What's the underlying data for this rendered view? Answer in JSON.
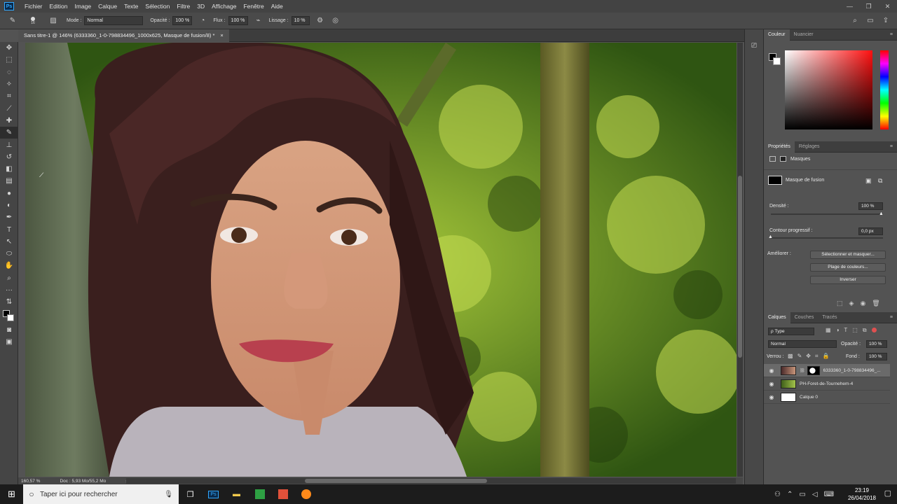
{
  "menu": [
    "Fichier",
    "Edition",
    "Image",
    "Calque",
    "Texte",
    "Sélection",
    "Filtre",
    "3D",
    "Affichage",
    "Fenêtre",
    "Aide"
  ],
  "app_logo": "Ps",
  "window_controls": [
    "—",
    "❐",
    "✕"
  ],
  "options": {
    "brush_size": "16",
    "mode_label": "Mode :",
    "mode_value": "Normal",
    "opacity_label": "Opacité :",
    "opacity_value": "100 %",
    "flow_label": "Flux :",
    "flow_value": "100 %",
    "smoothing_label": "Lissage :",
    "smoothing_value": "10 %"
  },
  "document": {
    "tab_title": "Sans titre-1 @ 146% (6333360_1-0-798834496_1000x625, Masque de fusion/8) *",
    "close": "×"
  },
  "status": {
    "zoom": "160,57 %",
    "doc": "Doc : 5,93 Mo/55,2 Mo",
    "arrow": "›"
  },
  "color_panel": {
    "tabs": [
      "Couleur",
      "Nuancier"
    ],
    "colors": {
      "fg": "#000000",
      "bg": "#ffffff",
      "hue": "#ff1010"
    }
  },
  "properties": {
    "tabs": [
      "Propriétés",
      "Réglages"
    ],
    "header": "Masques",
    "mask_name": "Masque de fusion",
    "density_label": "Densité :",
    "density_value": "100 %",
    "feather_label": "Contour progressif :",
    "feather_value": "0,0 px",
    "refine_label": "Améliorer :",
    "btn_select_mask": "Sélectionner et masquer...",
    "btn_color_range": "Plage de couleurs...",
    "btn_invert": "Inverser"
  },
  "layers_panel": {
    "tabs": [
      "Calques",
      "Couches",
      "Tracés"
    ],
    "filter": "ρ Type",
    "blend_mode": "Normal",
    "opacity_label": "Opacité :",
    "opacity_value": "100 %",
    "lock_label": "Verrou :",
    "fill_label": "Fond :",
    "fill_value": "100 %",
    "layers": [
      {
        "name": "6333360_1-0-798834496_...",
        "selected": true
      },
      {
        "name": "PH-Foret-de-Tournehem-4",
        "selected": false
      },
      {
        "name": "Calque 0",
        "selected": false
      }
    ]
  },
  "taskbar": {
    "search_placeholder": "Taper ici pour rechercher",
    "time": "23:19",
    "date": "26/04/2018"
  }
}
